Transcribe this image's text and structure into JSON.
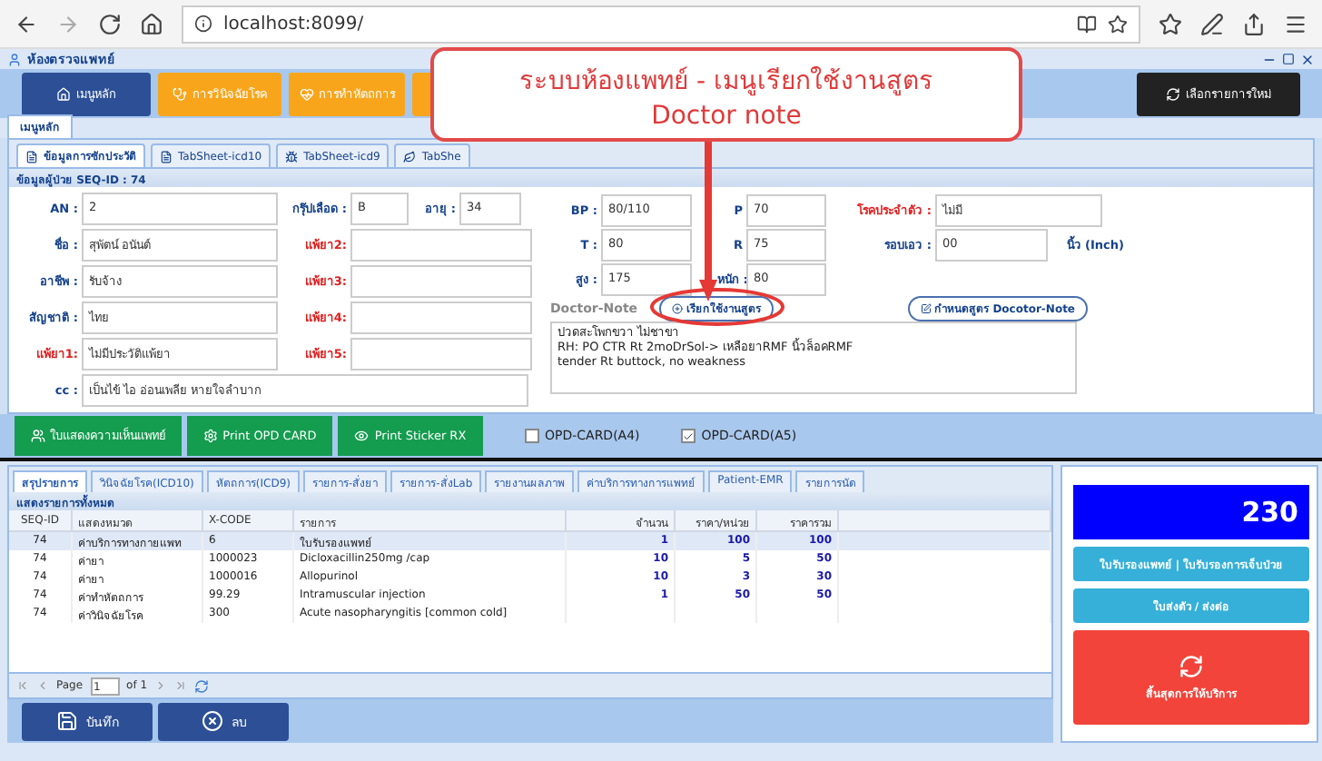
{
  "browser": {
    "url": "localhost:8099/"
  },
  "window": {
    "title": "ห้องตรวจแพทย์"
  },
  "menu_buttons": [
    {
      "label": "เมนูหลัก",
      "kind": "primary"
    },
    {
      "label": "การวินิจฉัยโรค",
      "kind": "warning"
    },
    {
      "label": "การทำหัตถการ",
      "kind": "warning"
    },
    {
      "kind": "warning"
    }
  ],
  "new_item_button": "เลือกรายการใหม่",
  "main_tab": {
    "label": "เมนูหลัก",
    "selected": true
  },
  "sheet_tabs": [
    {
      "label": "ข้อมูลการซักประวัติ",
      "selected": true
    },
    {
      "label": "TabSheet-icd10",
      "selected": false
    },
    {
      "label": "TabSheet-icd9",
      "selected": false
    },
    {
      "label": "TabShe",
      "selected": false
    }
  ],
  "section_title": "ข้อมูลผู้ป่วย SEQ-ID : 74",
  "form": {
    "an": {
      "label": "AN :",
      "value": "2"
    },
    "blood": {
      "label": "กรุ๊ปเลือด :",
      "value": "B"
    },
    "age": {
      "label": "อายุ :",
      "value": "34"
    },
    "name": {
      "label": "ชื่อ :",
      "value": "สุพัตน์ อนันต์"
    },
    "job": {
      "label": "อาชีพ :",
      "value": "รับจ้าง"
    },
    "nation": {
      "label": "สัญชาติ :",
      "value": "ไทย"
    },
    "allergy": [
      {
        "label": "แพ้ยา1:",
        "value": "ไม่มีประวัติแพ้ยา"
      },
      {
        "label": "แพ้ยา2:"
      },
      {
        "label": "แพ้ยา3:"
      },
      {
        "label": "แพ้ยา4:"
      },
      {
        "label": "แพ้ยา5:"
      }
    ],
    "cc": {
      "label": "cc :",
      "value": "เป็นไข้ ไอ อ่อนเพลีย หายใจลำบาก"
    },
    "bp": {
      "label": "BP :",
      "value": "80/110"
    },
    "p": {
      "label": "P",
      "value": "70"
    },
    "disease": {
      "label": "โรคประจำตัว :",
      "value": "ไม่มี"
    },
    "t": {
      "label": "T :",
      "value": "80"
    },
    "r": {
      "label": "R",
      "value": "75"
    },
    "waist": {
      "label": "รอบเอว :",
      "value": "00",
      "unit": "นิ้ว (Inch)"
    },
    "height": {
      "label": "สูง :",
      "value": "175"
    },
    "weight": {
      "label": "หนัก :",
      "value": "80"
    },
    "note_label": "Doctor-Note",
    "use_formula_button": "เรียกใช้งานสูตร",
    "define_formula_button": "กำหนดสูตร Docotor-Note",
    "note_lines": [
      "ปวดสะโพกขวา ไม่ชาขา",
      "RH: PO CTR Rt 2moDrSol-> เหลือยาRMF นิ้วล็อคRMF",
      "tender Rt buttock, no weakness"
    ]
  },
  "action_buttons": [
    "ใบแสดงความเห็นแพทย์",
    "Print OPD CARD",
    "Print Sticker RX"
  ],
  "print_options": [
    {
      "label": "OPD-CARD(A4)",
      "checked": false
    },
    {
      "label": "OPD-CARD(A5)",
      "checked": true
    }
  ],
  "bottom_tabs": [
    {
      "label": "สรุปรายการ",
      "selected": true
    },
    {
      "label": "วินิจฉัยโรค(ICD10)",
      "selected": false
    },
    {
      "label": "หัตถการ(ICD9)",
      "selected": false
    },
    {
      "label": "รายการ-สั่งยา",
      "selected": false
    },
    {
      "label": "รายการ-สั่งLab",
      "selected": false
    },
    {
      "label": "รายงานผลภาพ",
      "selected": false
    },
    {
      "label": "ค่าบริการทางการแพทย์",
      "selected": false
    },
    {
      "label": "Patient-EMR",
      "selected": false
    },
    {
      "label": "รายการนัด",
      "selected": false
    }
  ],
  "table": {
    "title": "แสดงรายการทั้งหมด",
    "columns": [
      "SEQ-ID",
      "แสดงหมวด",
      "X-CODE",
      "รายการ",
      "จำนวน",
      "ราคา/หน่วย",
      "ราคารวม"
    ],
    "rows": [
      {
        "selected": true,
        "cells": [
          "74",
          "ค่าบริการทางกายแพท",
          "6",
          "ใบรับรองแพทย์",
          "1",
          "100",
          "100"
        ]
      },
      {
        "selected": false,
        "cells": [
          "74",
          "ค่ายา",
          "1000023",
          "Dicloxacillin250mg /cap",
          "10",
          "5",
          "50"
        ]
      },
      {
        "selected": false,
        "cells": [
          "74",
          "ค่ายา",
          "1000016",
          "Allopurinol",
          "10",
          "3",
          "30"
        ]
      },
      {
        "selected": false,
        "cells": [
          "74",
          "ค่าทำหัตถการ",
          "99.29",
          "Intramuscular injection",
          "1",
          "50",
          "50"
        ]
      },
      {
        "selected": false,
        "cells": [
          "74",
          "ค่าวินิจฉัยโรค",
          "300",
          "Acute nasopharyngitis [common cold]",
          "",
          "",
          ""
        ]
      }
    ]
  },
  "pager": {
    "label": "Page",
    "page": "1",
    "of": "of 1"
  },
  "bottom_buttons": [
    "บันทึก",
    "ลบ"
  ],
  "total": "230",
  "side_buttons": [
    {
      "label": "ใบรับรองแพทย์ | ใบรับรองการเจ็บป่วย",
      "kind": "info"
    },
    {
      "label": "ใบส่งตัว / ส่งต่อ",
      "kind": "info"
    },
    {
      "label": "สิ้นสุดการให้บริการ",
      "kind": "danger"
    }
  ],
  "callout": {
    "title": "ระบบห้องแพทย์ - เมนูเรียกใช้งานสูตร",
    "subtitle": "Doctor note"
  }
}
